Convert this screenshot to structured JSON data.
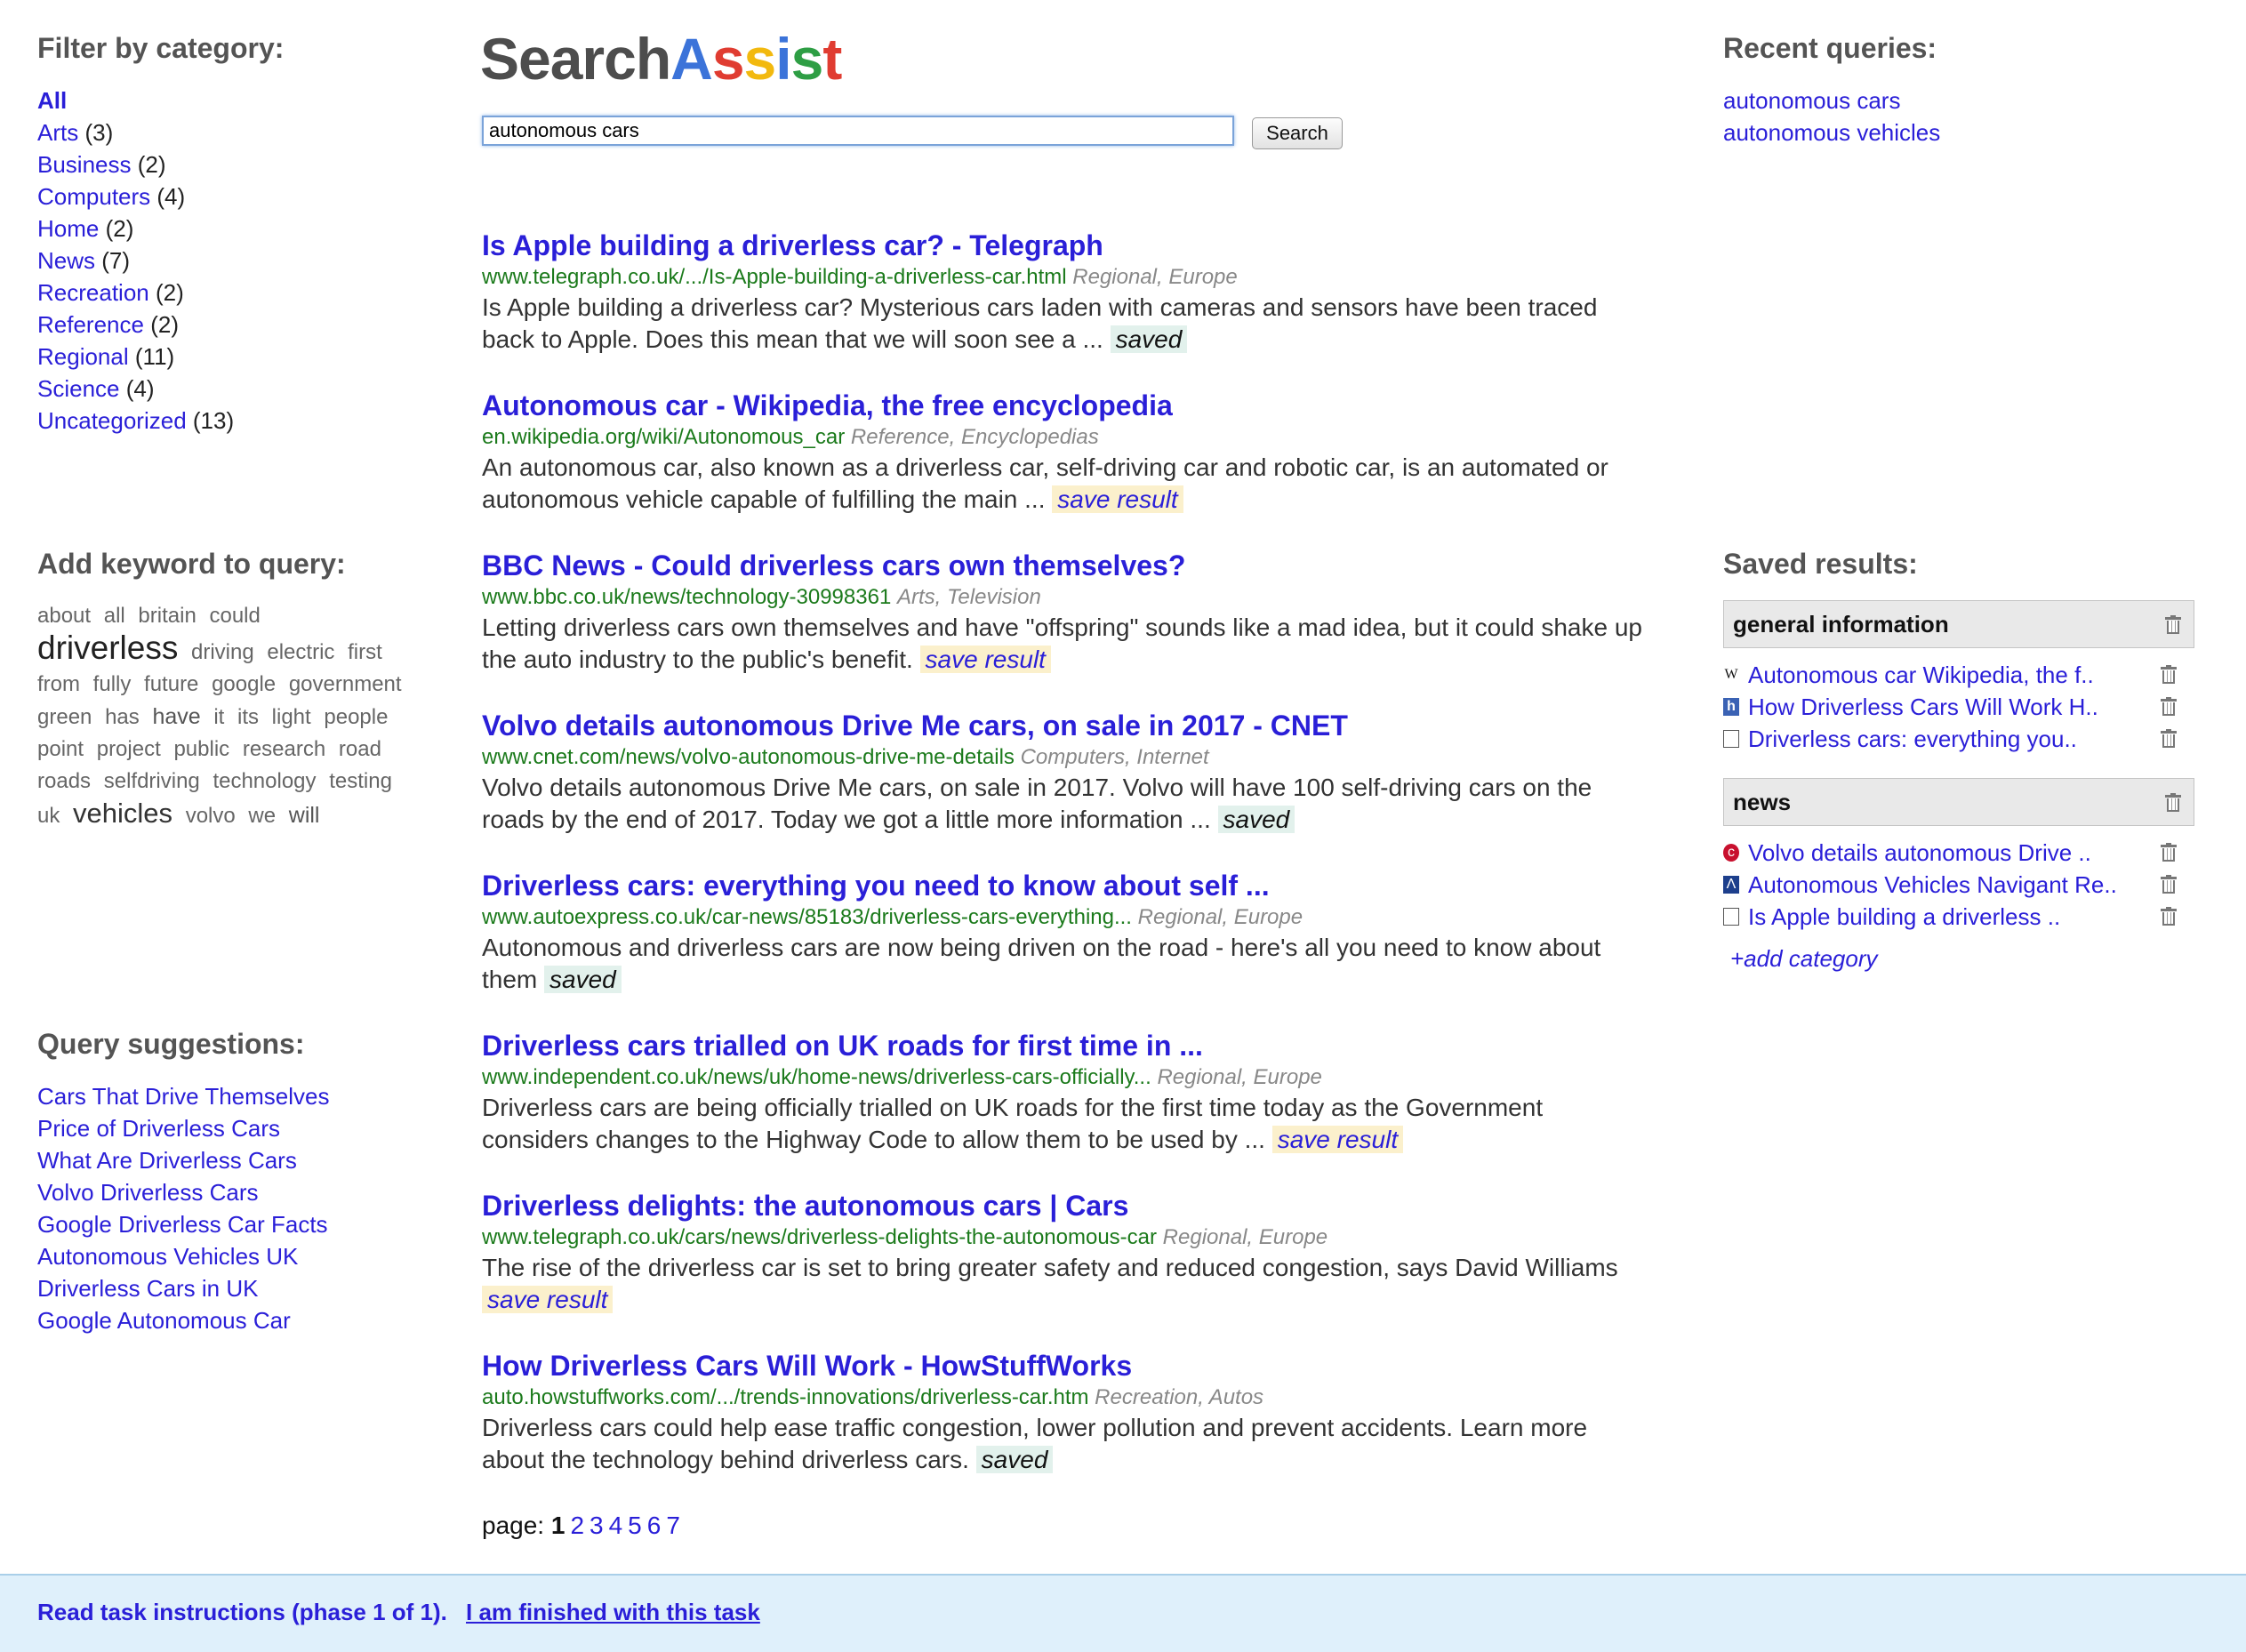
{
  "logo": {
    "letters": [
      {
        "ch": "Search",
        "color": "#4d4d4d"
      },
      {
        "ch": "A",
        "color": "#3b73d9"
      },
      {
        "ch": "s",
        "color": "#e03c31"
      },
      {
        "ch": "s",
        "color": "#f2b90f"
      },
      {
        "ch": "i",
        "color": "#3b73d9"
      },
      {
        "ch": "s",
        "color": "#2e9e44"
      },
      {
        "ch": "t",
        "color": "#e03c31"
      }
    ]
  },
  "search": {
    "value": "autonomous cars",
    "button_label": "Search"
  },
  "filter": {
    "title": "Filter by category:",
    "items": [
      {
        "label": "All",
        "count": ""
      },
      {
        "label": "Arts",
        "count": "(3)"
      },
      {
        "label": "Business",
        "count": "(2)"
      },
      {
        "label": "Computers",
        "count": "(4)"
      },
      {
        "label": "Home",
        "count": "(2)"
      },
      {
        "label": "News",
        "count": "(7)"
      },
      {
        "label": "Recreation",
        "count": "(2)"
      },
      {
        "label": "Reference",
        "count": "(2)"
      },
      {
        "label": "Regional",
        "count": "(11)"
      },
      {
        "label": "Science",
        "count": "(4)"
      },
      {
        "label": "Uncategorized",
        "count": "(13)"
      }
    ]
  },
  "keywords": {
    "title": "Add keyword to query:",
    "words": [
      {
        "w": "about",
        "s": 1
      },
      {
        "w": "all",
        "s": 1
      },
      {
        "w": "britain",
        "s": 1
      },
      {
        "w": "could",
        "s": 1
      },
      {
        "w": "driverless",
        "s": 4
      },
      {
        "w": "driving",
        "s": 1
      },
      {
        "w": "electric",
        "s": 1
      },
      {
        "w": "first",
        "s": 1
      },
      {
        "w": "from",
        "s": 1
      },
      {
        "w": "fully",
        "s": 1
      },
      {
        "w": "future",
        "s": 1
      },
      {
        "w": "google",
        "s": 1
      },
      {
        "w": "government",
        "s": 1
      },
      {
        "w": "green",
        "s": 1
      },
      {
        "w": "has",
        "s": 1
      },
      {
        "w": "have",
        "s": 2
      },
      {
        "w": "it",
        "s": 1
      },
      {
        "w": "its",
        "s": 1
      },
      {
        "w": "light",
        "s": 1
      },
      {
        "w": "people",
        "s": 1
      },
      {
        "w": "point",
        "s": 1
      },
      {
        "w": "project",
        "s": 1
      },
      {
        "w": "public",
        "s": 1
      },
      {
        "w": "research",
        "s": 1
      },
      {
        "w": "road",
        "s": 1
      },
      {
        "w": "roads",
        "s": 1
      },
      {
        "w": "selfdriving",
        "s": 1
      },
      {
        "w": "technology",
        "s": 1
      },
      {
        "w": "testing",
        "s": 1
      },
      {
        "w": "uk",
        "s": 1
      },
      {
        "w": "vehicles",
        "s": 3
      },
      {
        "w": "volvo",
        "s": 1
      },
      {
        "w": "we",
        "s": 1
      },
      {
        "w": "will",
        "s": 2
      }
    ]
  },
  "suggestions": {
    "title": "Query suggestions:",
    "items": [
      "Cars That Drive Themselves",
      "Price of Driverless Cars",
      "What Are Driverless Cars",
      "Volvo Driverless Cars",
      "Google Driverless Car Facts",
      "Autonomous Vehicles UK",
      "Driverless Cars in UK",
      "Google Autonomous Car"
    ]
  },
  "results": [
    {
      "title": "Is Apple building a driverless car? - Telegraph",
      "url": "www.telegraph.co.uk/.../Is-Apple-building-a-driverless-car.html",
      "cats": "Regional, Europe",
      "snippet": "Is Apple building a driverless car? Mysterious cars laden with cameras and sensors have been traced back to Apple. Does this mean that we will soon see a ...",
      "save": "saved",
      "saved": true
    },
    {
      "title": "Autonomous car - Wikipedia, the free encyclopedia",
      "url": "en.wikipedia.org/wiki/Autonomous_car",
      "cats": "Reference, Encyclopedias",
      "snippet": "An autonomous car, also known as a driverless car, self-driving car and robotic car, is an automated or autonomous vehicle capable of fulfilling the main ...",
      "save": "save result",
      "saved": false
    },
    {
      "title": "BBC News - Could driverless cars own themselves?",
      "url": "www.bbc.co.uk/news/technology-30998361",
      "cats": "Arts, Television",
      "snippet": "Letting driverless cars own themselves and have \"offspring\" sounds like a mad idea, but it could shake up the auto industry to the public's benefit.",
      "save": "save result",
      "saved": false
    },
    {
      "title": "Volvo details autonomous Drive Me cars, on sale in 2017 - CNET",
      "url": "www.cnet.com/news/volvo-autonomous-drive-me-details",
      "cats": "Computers, Internet",
      "snippet": "Volvo details autonomous Drive Me cars, on sale in 2017. Volvo will have 100 self-driving cars on the roads by the end of 2017. Today we got a little more information ...",
      "save": "saved",
      "saved": true
    },
    {
      "title": "Driverless cars: everything you need to know about self ...",
      "url": "www.autoexpress.co.uk/car-news/85183/driverless-cars-everything...",
      "cats": "Regional, Europe",
      "snippet": "Autonomous and driverless cars are now being driven on the road - here's all you need to know about them",
      "save": "saved",
      "saved": true
    },
    {
      "title": "Driverless cars trialled on UK roads for first time in ...",
      "url": "www.independent.co.uk/news/uk/home-news/driverless-cars-officially...",
      "cats": "Regional, Europe",
      "snippet": "Driverless cars are being officially trialled on UK roads for the first time today as the Government considers changes to the Highway Code to allow them to be used by ...",
      "save": "save result",
      "saved": false
    },
    {
      "title": "Driverless delights: the autonomous cars | Cars",
      "url": "www.telegraph.co.uk/cars/news/driverless-delights-the-autonomous-car",
      "cats": "Regional, Europe",
      "snippet": "The rise of the driverless car is set to bring greater safety and reduced congestion, says David Williams",
      "save": "save result",
      "saved": false
    },
    {
      "title": "How Driverless Cars Will Work - HowStuffWorks",
      "url": "auto.howstuffworks.com/.../trends-innovations/driverless-car.htm",
      "cats": "Recreation, Autos",
      "snippet": "Driverless cars could help ease traffic congestion, lower pollution and prevent accidents. Learn more about the technology behind driverless cars.",
      "save": "saved",
      "saved": true
    }
  ],
  "pager": {
    "label": "page:",
    "pages": [
      "1",
      "2",
      "3",
      "4",
      "5",
      "6",
      "7"
    ],
    "current": "1"
  },
  "recent": {
    "title": "Recent queries:",
    "items": [
      "autonomous cars",
      "autonomous vehicles"
    ]
  },
  "saved": {
    "title": "Saved results:",
    "groups": [
      {
        "name": "general information",
        "items": [
          {
            "icon": "wikipedia-icon",
            "glyph": "W",
            "cls": "fav-w",
            "label": "Autonomous car Wikipedia, the f.."
          },
          {
            "icon": "howstuffworks-icon",
            "glyph": "h",
            "cls": "fav-hsw",
            "label": "How Driverless Cars Will Work H.."
          },
          {
            "icon": "document-icon",
            "glyph": "",
            "cls": "fav-doc",
            "label": "Driverless cars: everything you.."
          }
        ]
      },
      {
        "name": "news",
        "items": [
          {
            "icon": "cnet-icon",
            "glyph": "c",
            "cls": "fav-cnet",
            "label": "Volvo details autonomous Drive .."
          },
          {
            "icon": "navigant-icon",
            "glyph": "Λ",
            "cls": "fav-nav",
            "label": "Autonomous Vehicles Navigant Re.."
          },
          {
            "icon": "document-icon",
            "glyph": "",
            "cls": "fav-doc",
            "label": "Is Apple building a driverless .."
          }
        ]
      }
    ],
    "add_label": "+add category"
  },
  "footer": {
    "instructions": "Read task instructions (phase 1 of 1).",
    "finished": "I am finished with this task"
  }
}
